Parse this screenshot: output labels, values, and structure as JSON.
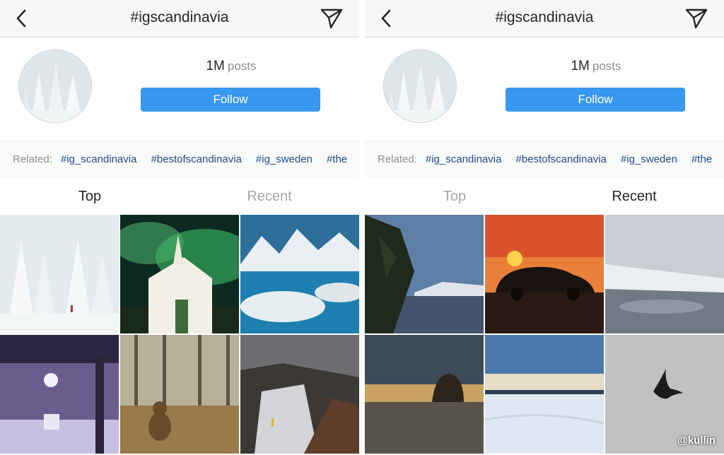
{
  "panels": [
    {
      "title": "#igscandinavia",
      "posts_count": "1M",
      "posts_label": "posts",
      "follow_label": "Follow",
      "related_label": "Related:",
      "related_tags": [
        "#ig_scandinavia",
        "#bestofscandinavia",
        "#ig_sweden",
        "#the"
      ],
      "tabs": [
        {
          "label": "Top",
          "active": true
        },
        {
          "label": "Recent",
          "active": false
        }
      ]
    },
    {
      "title": "#igscandinavia",
      "posts_count": "1M",
      "posts_label": "posts",
      "follow_label": "Follow",
      "related_label": "Related:",
      "related_tags": [
        "#ig_scandinavia",
        "#bestofscandinavia",
        "#ig_sweden",
        "#the"
      ],
      "tabs": [
        {
          "label": "Top",
          "active": false
        },
        {
          "label": "Recent",
          "active": true
        }
      ]
    }
  ],
  "watermark": "@kullin",
  "colors": {
    "follow": "#3897f0",
    "hashtag": "#1f4b8a",
    "muted": "#8e8e8e"
  }
}
